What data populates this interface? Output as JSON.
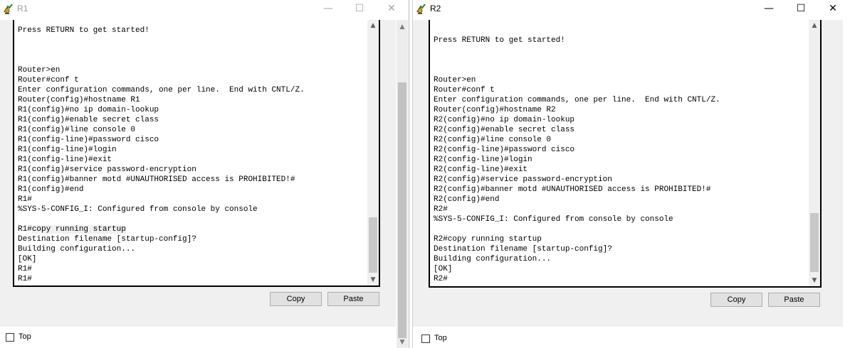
{
  "windows": {
    "r1": {
      "title": "R1",
      "controls": {
        "minimize": "—",
        "maximize": "☐",
        "close": "✕"
      },
      "terminal_lines_before": [
        "Press RETURN to get started!",
        "",
        "",
        "",
        "Router>en",
        "Router#conf t",
        "Enter configuration commands, one per line.  End with CNTL/Z.",
        "Router(config)#hostname R1",
        "R1(config)#no ip domain-lookup",
        "R1(config)#enable secret class",
        "R1(config)#line console 0",
        "R1(config-line)#password cisco",
        "R1(config-line)#login",
        "R1(config-line)#exit",
        "R1(config)#service password-encryption",
        "R1(config)#banner motd #UNAUTHORISED access is PROHIBITED!#",
        "R1(config)#end",
        "R1#",
        "%SYS-5-CONFIG_I: Configured from console by console",
        ""
      ],
      "highlight_prompt": "R1#",
      "highlight_command": "copy running startup",
      "terminal_lines_after": [
        "Destination filename [startup-config]?",
        "Building configuration...",
        "[OK]",
        "R1#",
        "R1#"
      ],
      "copy_label": "Copy",
      "paste_label": "Paste",
      "top_label": "Top"
    },
    "r2": {
      "title": "R2",
      "controls": {
        "minimize": "—",
        "maximize": "☐",
        "close": "✕"
      },
      "terminal_lines": [
        "",
        "Press RETURN to get started!",
        "",
        "",
        "",
        "Router>en",
        "Router#conf t",
        "Enter configuration commands, one per line.  End with CNTL/Z.",
        "Router(config)#hostname R2",
        "R2(config)#no ip domain-lookup",
        "R2(config)#enable secret class",
        "R2(config)#line console 0",
        "R2(config-line)#password cisco",
        "R2(config-line)#login",
        "R2(config-line)#exit",
        "R2(config)#service password-encryption",
        "R2(config)#banner motd #UNAUTHORISED access is PROHIBITED!#",
        "R2(config)#end",
        "R2#",
        "%SYS-5-CONFIG_I: Configured from console by console",
        "",
        "R2#copy running startup",
        "Destination filename [startup-config]?",
        "Building configuration...",
        "[OK]",
        "R2#"
      ],
      "copy_label": "Copy",
      "paste_label": "Paste",
      "top_label": "Top"
    }
  },
  "icons": {
    "app": "packet-tracer-router-icon",
    "scroll_up": "▲",
    "scroll_down": "▼"
  }
}
